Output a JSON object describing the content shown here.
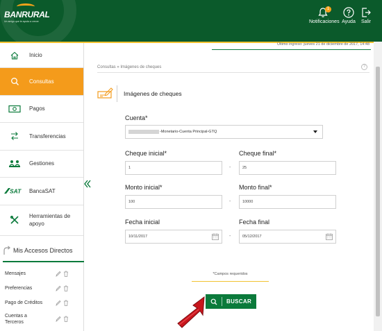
{
  "header": {
    "logo_text": "BANRURAL",
    "logo_tagline": "Un amigo que te ayuda a crecer",
    "notifications_label": "Notificaciones",
    "notifications_count": "1",
    "help_label": "Ayuda",
    "exit_label": "Salir"
  },
  "info": {
    "last_login": "Último ingreso: jueves 21 de diciembre de 2017, 14:48"
  },
  "sidebar": {
    "items": [
      {
        "label": "Inicio"
      },
      {
        "label": "Consultas"
      },
      {
        "label": "Pagos"
      },
      {
        "label": "Transferencias"
      },
      {
        "label": "Gestiones"
      },
      {
        "label": "BancaSAT"
      },
      {
        "label": "Herramientas de apoyo"
      }
    ],
    "sat_logo": "SAT",
    "accesos_title": "Mis Accesos Directos",
    "accesos": [
      {
        "label": "Mensajes"
      },
      {
        "label": "Preferencias"
      },
      {
        "label": "Pago de Créditos"
      },
      {
        "label": "Cuentas a Terceros"
      }
    ]
  },
  "main": {
    "breadcrumb": "Consultas » Imágenes de cheques",
    "help": "?",
    "title": "Imágenes de cheques",
    "cuenta_label": "Cuenta*",
    "cuenta_value": "-Monetario-Cuenta Principal-GTQ",
    "cheque_inicial_label": "Cheque inicial*",
    "cheque_inicial_value": "1",
    "cheque_final_label": "Cheque final*",
    "cheque_final_value": "25",
    "monto_inicial_label": "Monto inicial*",
    "monto_inicial_value": "100",
    "monto_final_label": "Monto final*",
    "monto_final_value": "10000",
    "fecha_inicial_label": "Fecha inicial",
    "fecha_inicial_value": "10/11/2017",
    "fecha_final_label": "Fecha final",
    "fecha_final_value": "05/12/2017",
    "separator": "-",
    "required_note": "*Campos requeridos",
    "buscar_label": "BUSCAR"
  },
  "colors": {
    "brand_green": "#0b5a2b",
    "button_green": "#0b7a3b",
    "accent_orange": "#f49b1b",
    "accent_yellow": "#f2c230",
    "cursor_red": "#c8161d"
  }
}
